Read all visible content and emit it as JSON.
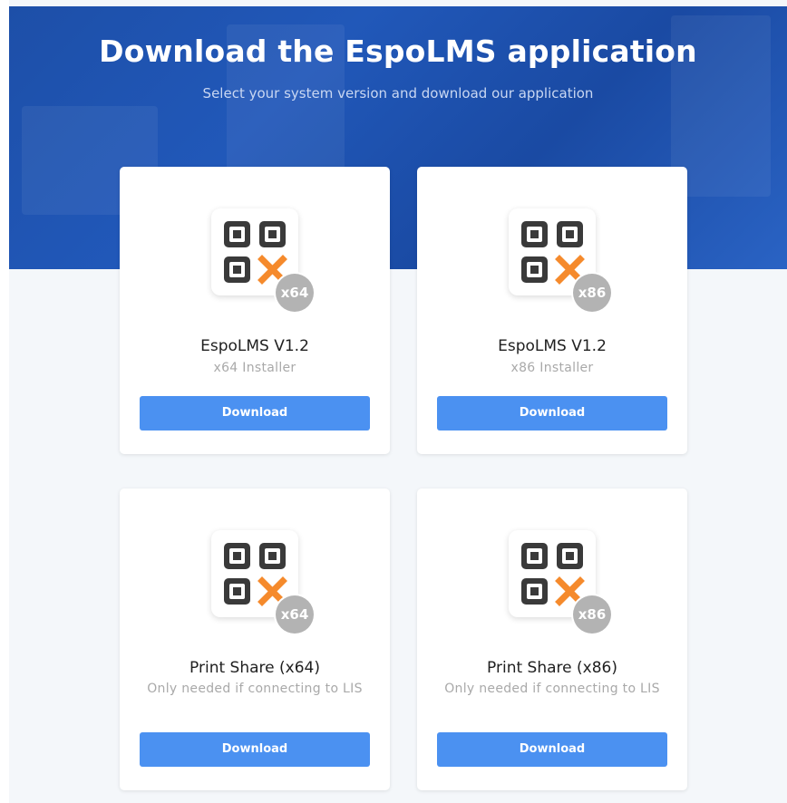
{
  "hero": {
    "title": "Download the EspoLMS application",
    "subtitle": "Select your system version and download our application"
  },
  "colors": {
    "hero_blue": "#1d4fa8",
    "button_blue": "#4b91f1",
    "badge_gray": "#b3b3b3",
    "logo_dark": "#3a3a3a",
    "logo_orange": "#f58a2c"
  },
  "cards": [
    {
      "title": "EspoLMS V1.2",
      "subtitle": "x64 Installer",
      "badge": "x64",
      "button_label": "Download",
      "icon": "espolms-app-icon"
    },
    {
      "title": "EspoLMS V1.2",
      "subtitle": "x86 Installer",
      "badge": "x86",
      "button_label": "Download",
      "icon": "espolms-app-icon"
    },
    {
      "title": "Print Share (x64)",
      "subtitle": "Only needed if connecting to LIS",
      "badge": "x64",
      "button_label": "Download",
      "icon": "espolms-app-icon"
    },
    {
      "title": "Print Share (x86)",
      "subtitle": "Only needed if connecting to LIS",
      "badge": "x86",
      "button_label": "Download",
      "icon": "espolms-app-icon"
    }
  ]
}
